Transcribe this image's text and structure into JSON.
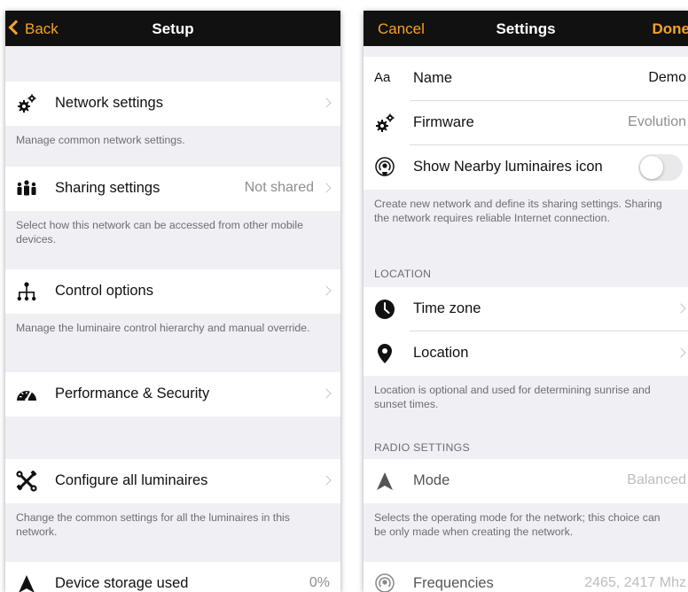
{
  "setup": {
    "nav": {
      "back_label": "Back",
      "title": "Setup"
    },
    "network": {
      "label": "Network settings",
      "note": "Manage common network settings."
    },
    "sharing": {
      "label": "Sharing settings",
      "value": "Not shared",
      "note": "Select how this network can be accessed from other mobile devices."
    },
    "control": {
      "label": "Control options",
      "note": "Manage the luminaire control hierarchy and manual override."
    },
    "performance": {
      "label": "Performance & Security"
    },
    "configure": {
      "label": "Configure all luminaires",
      "note": "Change the common settings for all the luminaires in this network."
    },
    "storage": {
      "label": "Device storage used",
      "value": "0%"
    }
  },
  "settings": {
    "nav": {
      "cancel_label": "Cancel",
      "title": "Settings",
      "done_label": "Done"
    },
    "name": {
      "icon_text": "Aa",
      "label": "Name",
      "value": "Demo"
    },
    "firmware": {
      "label": "Firmware",
      "value": "Evolution"
    },
    "nearby": {
      "label": "Show Nearby luminaires icon",
      "toggle_on": false
    },
    "nearby_note": "Create new network and define its sharing settings. Sharing the network requires reliable Internet connection.",
    "location_header": "LOCATION",
    "timezone": {
      "label": "Time zone"
    },
    "location": {
      "label": "Location"
    },
    "location_note": "Location is optional and used for determining sunrise and sunset times.",
    "radio_header": "RADIO SETTINGS",
    "mode": {
      "label": "Mode",
      "value": "Balanced"
    },
    "mode_note": "Selects the operating mode for the network; this choice can be only made when creating the network.",
    "frequencies": {
      "label": "Frequencies",
      "value": "2465, 2417 Mhz"
    }
  },
  "colors": {
    "accent": "#f7a128",
    "navbar": "#111111",
    "background": "#efeff4"
  }
}
